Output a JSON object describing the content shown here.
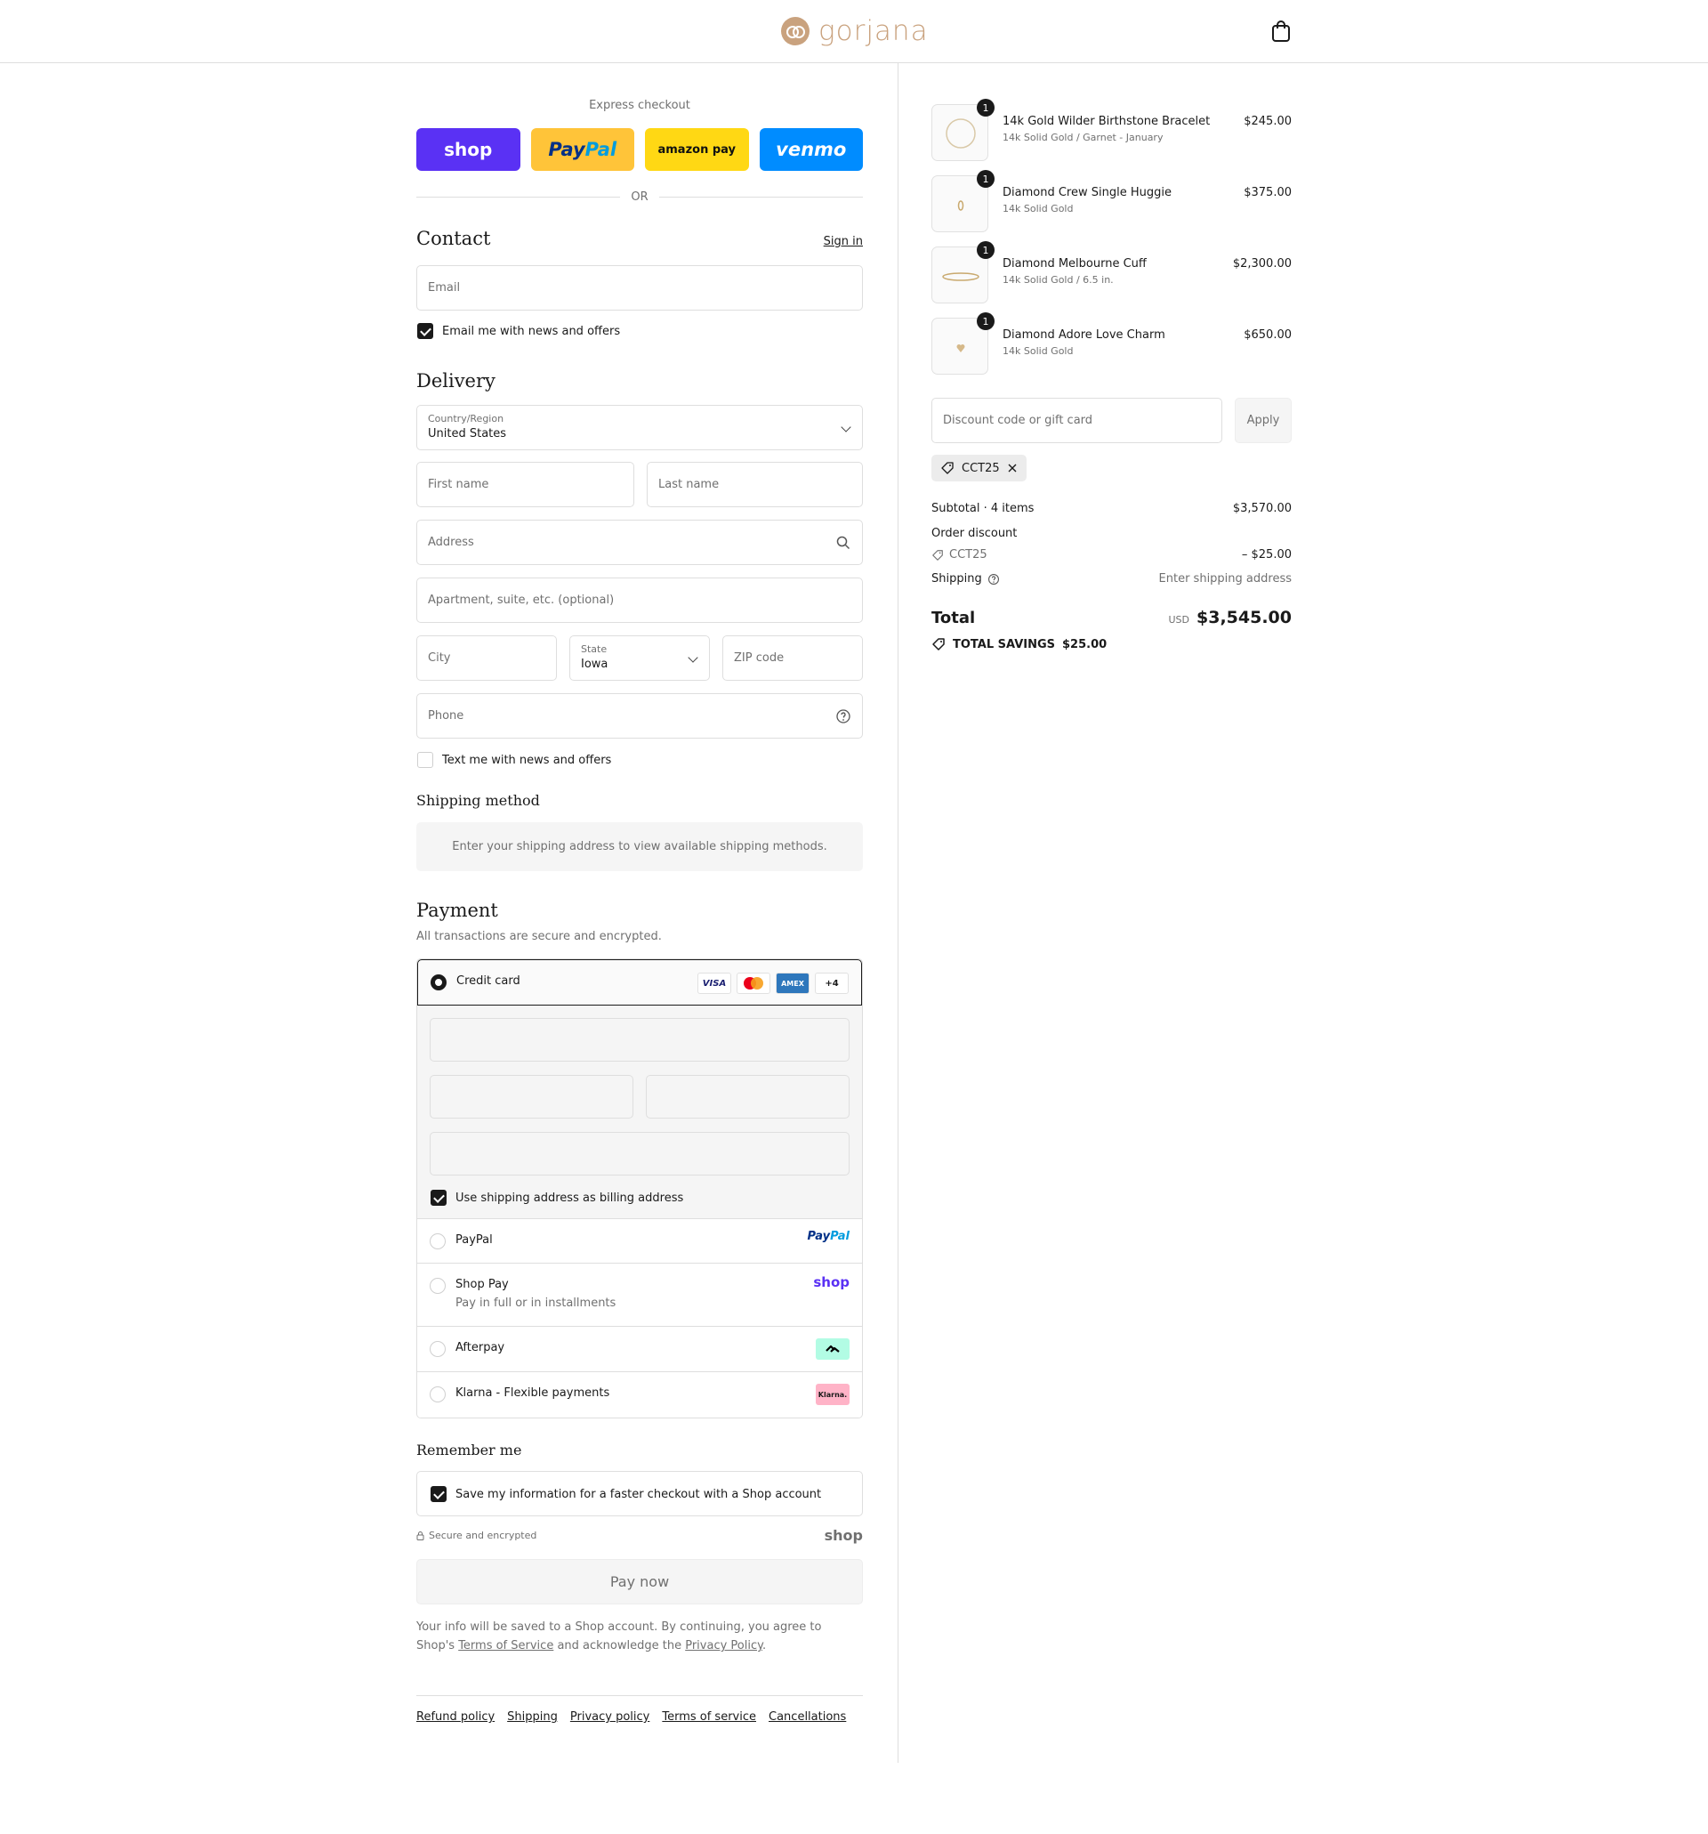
{
  "header": {
    "brand": "gorjana",
    "cart_icon": "shopping-bag-icon"
  },
  "express": {
    "label": "Express checkout",
    "buttons": {
      "shop": "shop",
      "paypal_a": "Pay",
      "paypal_b": "Pal",
      "amazon": "amazon pay",
      "venmo": "venmo"
    },
    "or": "OR"
  },
  "contact": {
    "title": "Contact",
    "sign_in": "Sign in",
    "email_placeholder": "Email",
    "news_label": "Email me with news and offers",
    "news_checked": true
  },
  "delivery": {
    "title": "Delivery",
    "country_label": "Country/Region",
    "country_value": "United States",
    "first_name": "First name",
    "last_name": "Last name",
    "address": "Address",
    "apartment": "Apartment, suite, etc. (optional)",
    "city": "City",
    "state_label": "State",
    "state_value": "Iowa",
    "zip": "ZIP code",
    "phone": "Phone",
    "text_label": "Text me with news and offers",
    "text_checked": false
  },
  "shipping_method": {
    "title": "Shipping method",
    "message": "Enter your shipping address to view available shipping methods."
  },
  "payment": {
    "title": "Payment",
    "subtitle": "All transactions are secure and encrypted.",
    "credit_card": "Credit card",
    "card_brands": {
      "visa": "VISA",
      "amex": "AMEX",
      "more": "+4"
    },
    "billing_label": "Use shipping address as billing address",
    "billing_checked": true,
    "options": {
      "paypal": "PayPal",
      "paypal_logo_a": "Pay",
      "paypal_logo_b": "Pal",
      "shop_pay": "Shop Pay",
      "shop_pay_sub": "Pay in full or in installments",
      "shop_logo": "shop",
      "afterpay": "Afterpay",
      "klarna": "Klarna - Flexible payments",
      "klarna_logo": "Klarna."
    }
  },
  "remember": {
    "title": "Remember me",
    "label": "Save my information for a faster checkout with a Shop account",
    "checked": true,
    "secure": "Secure and encrypted",
    "shop_logo": "shop"
  },
  "pay_now": "Pay now",
  "legal": {
    "text1": "Your info will be saved to a Shop account. By continuing, you agree to Shop's ",
    "terms": "Terms of Service",
    "text2": " and acknowledge the ",
    "privacy": "Privacy Policy",
    "text3": "."
  },
  "footer": {
    "links": [
      "Refund policy",
      "Shipping",
      "Privacy policy",
      "Terms of service",
      "Cancellations"
    ]
  },
  "order": {
    "items": [
      {
        "name": "14k Gold Wilder Birthstone Bracelet",
        "variant": "14k Solid Gold / Garnet - January",
        "price": "$245.00",
        "qty": "1"
      },
      {
        "name": "Diamond Crew Single Huggie",
        "variant": "14k Solid Gold",
        "price": "$375.00",
        "qty": "1"
      },
      {
        "name": "Diamond Melbourne Cuff",
        "variant": "14k Solid Gold / 6.5 in.",
        "price": "$2,300.00",
        "qty": "1"
      },
      {
        "name": "Diamond Adore Love Charm",
        "variant": "14k Solid Gold",
        "price": "$650.00",
        "qty": "1"
      }
    ],
    "discount_placeholder": "Discount code or gift card",
    "apply": "Apply",
    "code_chip": "CCT25",
    "subtotal_label": "Subtotal · 4 items",
    "subtotal": "$3,570.00",
    "order_discount": "Order discount",
    "discount_code": "CCT25",
    "discount_value": "– $25.00",
    "shipping_label": "Shipping",
    "shipping_value": "Enter shipping address",
    "total_label": "Total",
    "currency": "USD",
    "total": "$3,545.00",
    "savings_label": "TOTAL SAVINGS",
    "savings_value": "$25.00"
  }
}
